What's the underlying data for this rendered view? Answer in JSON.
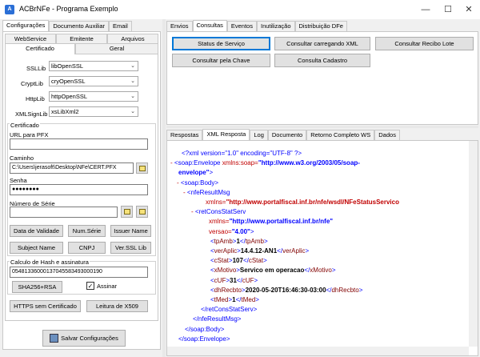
{
  "window": {
    "title": "ACBrNFe - Programa Exemplo",
    "icon": "acbr-app-icon"
  },
  "left_tabs": [
    "Configurações",
    "Documento Auxiliar",
    "Email"
  ],
  "config_subtabs_row1": [
    "WebService",
    "Emitente",
    "Arquivos"
  ],
  "config_subtabs_row2": [
    "Certificado",
    "Geral"
  ],
  "libs": [
    {
      "label": "SSLLib",
      "value": "libOpenSSL"
    },
    {
      "label": "CryptLib",
      "value": "cryOpenSSL"
    },
    {
      "label": "HttpLib",
      "value": "httpOpenSSL"
    },
    {
      "label": "XMLSignLib",
      "value": "xsLibXml2"
    }
  ],
  "certificado": {
    "group_label": "Certificado",
    "url_pfx_label": "URL para PFX",
    "url_pfx_value": "",
    "caminho_label": "Caminho",
    "caminho_value": "C:\\Users\\jerasoft\\Desktop\\NFe\\CERT.PFX",
    "senha_label": "Senha",
    "senha_value": "●●●●●●●●",
    "numero_serie_label": "Número de Série",
    "numero_serie_value": ""
  },
  "cert_buttons": [
    "Data de Validade",
    "Num.Série",
    "Issuer Name",
    "Subject Name",
    "CNPJ",
    "Ver.SSL Lib"
  ],
  "hash": {
    "label": "Calculo de Hash e assinatura",
    "value": "05481336000137045583493000190",
    "button": "SHA256+RSA",
    "assinar_label": "Assinar",
    "assinar_checked": true
  },
  "bottom_buttons": [
    "HTTPS sem Certificado",
    "Leitura de X509"
  ],
  "save_button": "Salvar Configurações",
  "right_tabs": [
    "Envios",
    "Consultas",
    "Eventos",
    "Inutilização",
    "Distribuição DFe"
  ],
  "consultas_buttons": {
    "status": "Status de Serviço",
    "carregando_xml": "Consultar carregando XML",
    "recibo_lote": "Consultar Recibo Lote",
    "pela_chave": "Consultar pela Chave",
    "cadastro": "Consulta Cadastro"
  },
  "response_tabs": [
    "Respostas",
    "XML Resposta",
    "Log",
    "Documento",
    "Retorno Completo WS",
    "Dados"
  ],
  "xml": {
    "l1": "<?xml version=\"1.0\" encoding=\"UTF-8\" ?>",
    "l2_tag": "<soap:Envelope",
    "l2_attr": " xmlns:soap=",
    "l2_val": "\"http://www.w3.org/2003/05/soap-",
    "l3_val": "envelope\"",
    "l3_close": ">",
    "l4": "<soap:Body>",
    "l5": "<nfeResultMsg",
    "l6_attr": "xmlns=",
    "l6_val": "\"http://www.portalfiscal.inf.br/nfe/wsdl/NFeStatusServico",
    "l7": "<retConsStatServ",
    "l8_attr": "xmlns=",
    "l8_val": "\"http://www.portalfiscal.inf.br/nfe\"",
    "l9_attr": "versao=",
    "l9_val": "\"4.00\"",
    "l9_close": ">",
    "tpAmb": "1",
    "verAplic": "14.4.12-AN1",
    "cStat": "107",
    "xMotivo": "Servico em operacao",
    "cUF": "31",
    "dhRecbto": "2020-05-20T16:46:30-03:00",
    "tMed": "1",
    "close_ret": "</retConsStatServ>",
    "close_nfe": "</nfeResultMsg>",
    "close_body": "</soap:Body>",
    "close_env": "</soap:Envelope>"
  }
}
